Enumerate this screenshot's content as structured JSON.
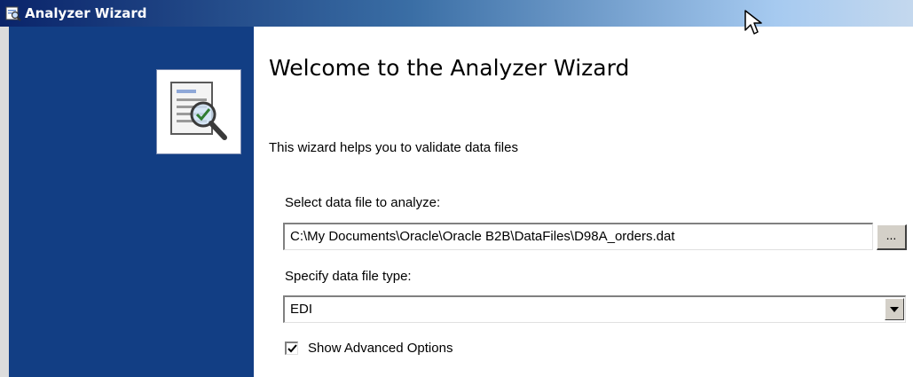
{
  "window": {
    "title": "Analyzer Wizard",
    "title_icon": "wizard-app-icon"
  },
  "side_panel": {
    "icon": "document-magnifier-icon",
    "color": "#123e84"
  },
  "content": {
    "heading": "Welcome to the Analyzer Wizard",
    "description": "This wizard helps you to validate data files",
    "file_label": "Select data file to analyze:",
    "file_value": "C:\\My Documents\\Oracle\\Oracle B2B\\DataFiles\\D98A_orders.dat",
    "browse_label": "...",
    "type_label": "Specify data file type:",
    "type_value": "EDI",
    "advanced_checkbox_label": "Show Advanced Options",
    "advanced_checked": true
  }
}
